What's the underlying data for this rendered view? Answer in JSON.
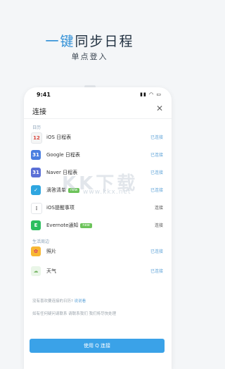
{
  "hero": {
    "title_accent": "一键",
    "title_rest": "同步日程",
    "subtitle": "单点登入"
  },
  "status_bar": {
    "time": "9:41",
    "icons": "▮▮ ◠ ▭"
  },
  "header": {
    "title": "连接",
    "close_glyph": "✕"
  },
  "sections": [
    {
      "label": "日历"
    },
    {
      "label": "生活周边"
    }
  ],
  "calendar_rows": [
    {
      "icon_text": "12",
      "icon_color": "#f5f5f5",
      "icon_fg": "#d9453b",
      "label": "iOS 日程表",
      "badge": "",
      "status": "已连接",
      "linked": true
    },
    {
      "icon_text": "31",
      "icon_color": "#4a7fe0",
      "icon_fg": "#ffffff",
      "label": "Google 日程表",
      "badge": "",
      "status": "已连接",
      "linked": true
    },
    {
      "icon_text": "31",
      "icon_color": "#5a6fd6",
      "icon_fg": "#ffffff",
      "label": "Naver 日程表",
      "badge": "",
      "status": "已连接",
      "linked": true
    },
    {
      "icon_text": "✓",
      "icon_color": "#2fa6e0",
      "icon_fg": "#ffffff",
      "label": "滴答清单",
      "badge": "new",
      "status": "已连接",
      "linked": true
    },
    {
      "icon_text": "⋮",
      "icon_color": "#ffffff",
      "icon_fg": "#444444",
      "label": "iOS提醒事项",
      "badge": "",
      "status": "连接",
      "linked": false
    },
    {
      "icon_text": "E",
      "icon_color": "#2dbe60",
      "icon_fg": "#ffffff",
      "label": "Evernote通知",
      "badge": "new",
      "status": "连接",
      "linked": false
    }
  ],
  "life_rows": [
    {
      "icon_text": "✿",
      "icon_color": "#f7b733",
      "icon_fg": "#d6336c",
      "label": "照片",
      "badge": "",
      "status": "已连接",
      "linked": true
    },
    {
      "icon_text": "☁",
      "icon_color": "#eaf6e8",
      "icon_fg": "#7cb86a",
      "label": "天气",
      "badge": "",
      "status": "已连接",
      "linked": true
    }
  ],
  "footer": {
    "line1": "没有喜欢要连接的日历?",
    "line1_link": "说说看",
    "line2": "如有任何疑问请联系 请联系我们 我们将尽快处理"
  },
  "cta": {
    "label": "使用 Q 连接"
  },
  "watermark": {
    "main": "KK下载",
    "sub": "www.kkx.net"
  }
}
